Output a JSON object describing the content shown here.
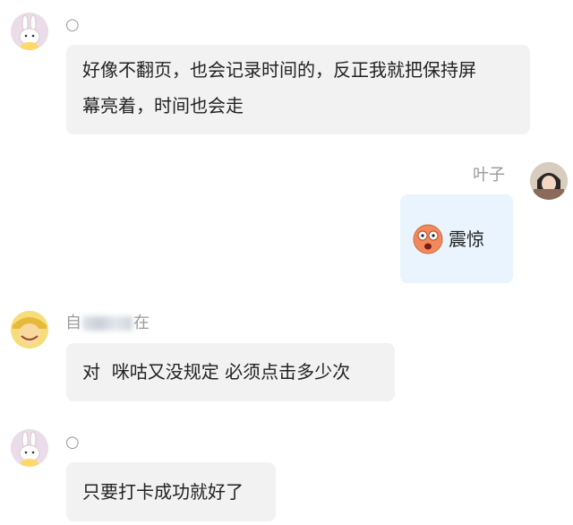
{
  "messages": [
    {
      "sender": "○",
      "text": "好像不翻页，也会记录时间的，反正我就把保持屏幕亮着，时间也会走",
      "line1": "好像不翻页，也会记录时间的，反正我就把保持屏",
      "line2": "幕亮着，时间也会走"
    },
    {
      "sender": "叶子",
      "emoji": "震惊"
    },
    {
      "sender_visible_prefix": "自",
      "sender_visible_suffix": "在",
      "text": "对  咪咕又没规定 必须点击多少次"
    },
    {
      "sender": "○",
      "text": "只要打卡成功就好了"
    }
  ]
}
